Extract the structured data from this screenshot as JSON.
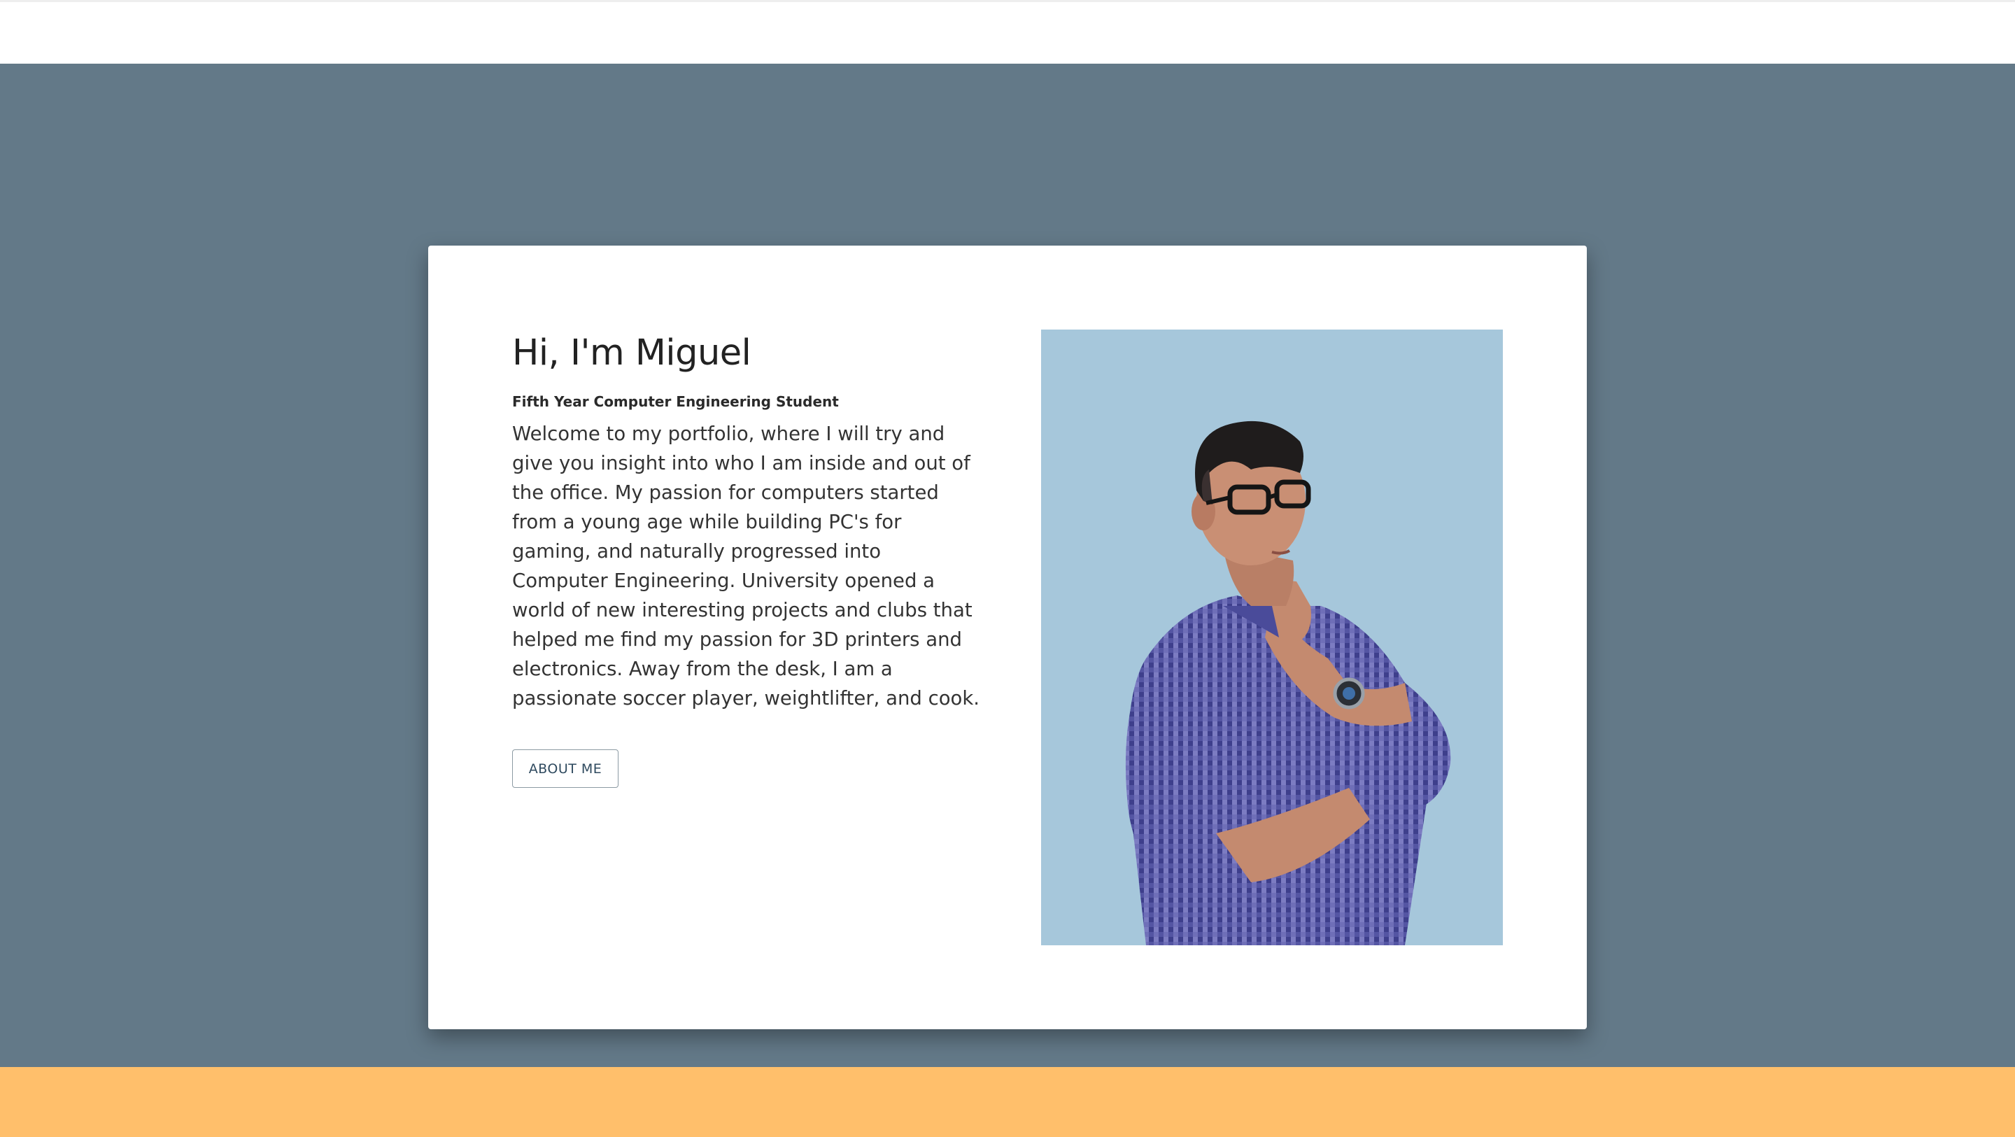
{
  "intro": {
    "heading": "Hi, I'm Miguel",
    "subheading": "Fifth Year Computer Engineering Student",
    "bio": "Welcome to my portfolio, where I will try and give you insight into who I am inside and out of the office. My passion for computers started from a young age while building PC's for gaming, and naturally progressed into Computer Engineering. University opened a world of new interesting projects and clubs that helped me find my passion for 3D printers and electronics. Away from the desk, I am a passionate soccer player, weightlifter, and cook.",
    "button_label": "ABOUT ME"
  },
  "colors": {
    "hero_background": "#637988",
    "footer_background": "#ffbf6b",
    "photo_background": "#a6c7db",
    "card_background": "#ffffff"
  }
}
